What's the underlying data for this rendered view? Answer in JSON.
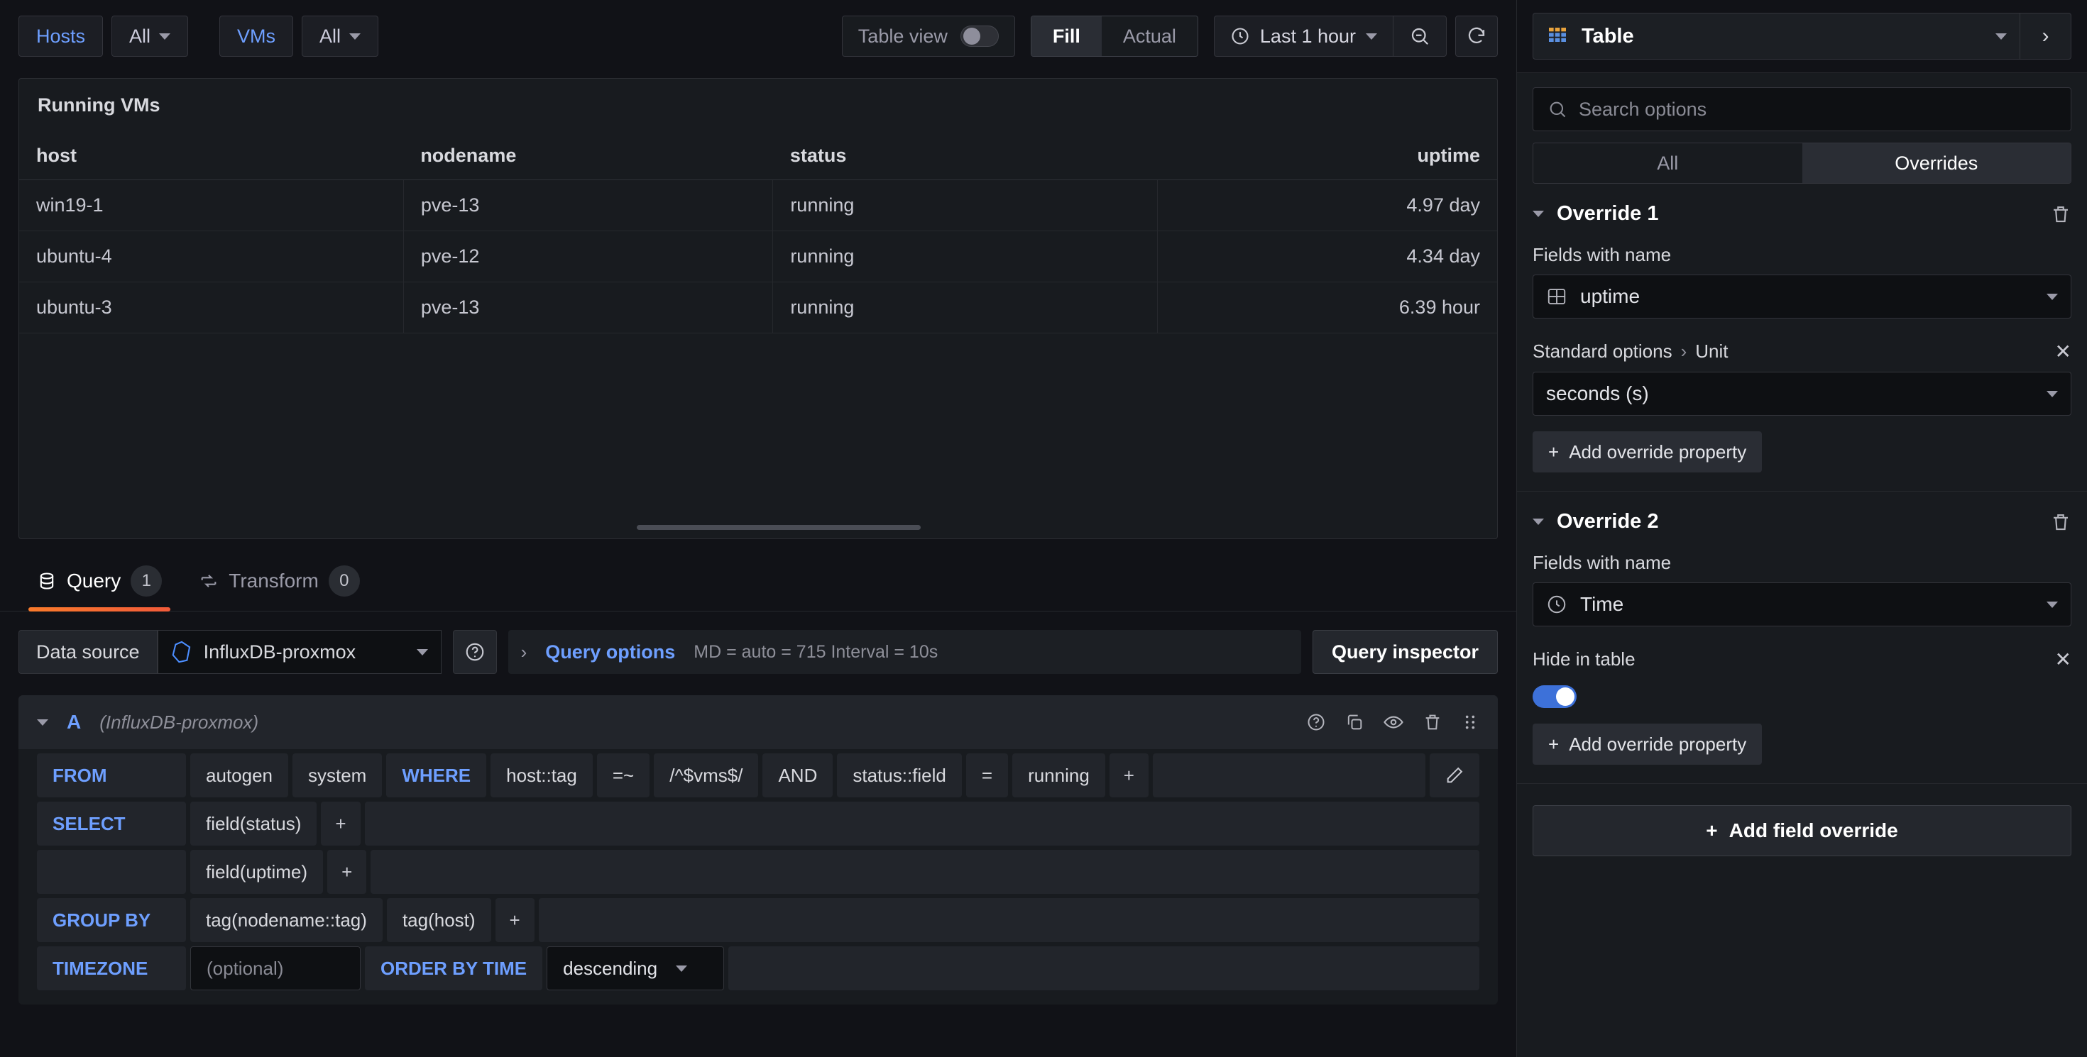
{
  "toolbar": {
    "hosts_label": "Hosts",
    "hosts_value": "All",
    "vms_label": "VMs",
    "vms_value": "All",
    "table_view_label": "Table view",
    "fill_label": "Fill",
    "actual_label": "Actual",
    "time_range": "Last 1 hour",
    "zoom_out_icon": "zoom-out-icon",
    "refresh_icon": "refresh-icon"
  },
  "panel": {
    "title": "Running VMs",
    "columns": [
      "host",
      "nodename",
      "status",
      "uptime"
    ],
    "rows": [
      {
        "host": "win19-1",
        "nodename": "pve-13",
        "status": "running",
        "uptime": "4.97 day"
      },
      {
        "host": "ubuntu-4",
        "nodename": "pve-12",
        "status": "running",
        "uptime": "4.34 day"
      },
      {
        "host": "ubuntu-3",
        "nodename": "pve-13",
        "status": "running",
        "uptime": "6.39 hour"
      }
    ]
  },
  "tabs": {
    "query_label": "Query",
    "query_count": "1",
    "transform_label": "Transform",
    "transform_count": "0"
  },
  "datasource": {
    "label": "Data source",
    "value": "InfluxDB-proxmox",
    "query_options_label": "Query options",
    "query_options_meta": "MD = auto = 715    Interval = 10s",
    "query_inspector_label": "Query inspector"
  },
  "query": {
    "ref_id": "A",
    "ds_name": "(InfluxDB-proxmox)",
    "from_kw": "FROM",
    "from_policy": "autogen",
    "from_measurement": "system",
    "where_kw": "WHERE",
    "where_tag": "host::tag",
    "where_op": "=~",
    "where_value": "/^$vms$/",
    "where_and": "AND",
    "where_tag2": "status::field",
    "where_op2": "=",
    "where_value2": "running",
    "plus": "+",
    "select_kw": "SELECT",
    "select_field1": "field(status)",
    "select_field2": "field(uptime)",
    "groupby_kw": "GROUP BY",
    "groupby_1": "tag(nodename::tag)",
    "groupby_2": "tag(host)",
    "timezone_kw": "TIMEZONE",
    "timezone_placeholder": "(optional)",
    "orderby_kw": "ORDER BY TIME",
    "orderby_value": "descending"
  },
  "side": {
    "viz_name": "Table",
    "viz_icon": "table-icon",
    "search_placeholder": "Search options",
    "tab_all": "All",
    "tab_overrides": "Overrides",
    "add_field_override": "Add field override",
    "overrides": [
      {
        "title": "Override 1",
        "matcher_label": "Fields with name",
        "matcher_value": "uptime",
        "matcher_icon": "field-icon",
        "property_label": "Standard options",
        "property_sep": "›",
        "property_name": "Unit",
        "property_value": "seconds (s)",
        "property_kind": "select",
        "add_property_label": "Add override property",
        "close_label": "✕"
      },
      {
        "title": "Override 2",
        "matcher_label": "Fields with name",
        "matcher_value": "Time",
        "matcher_icon": "clock-icon",
        "property_label": "Hide in table",
        "property_sep": "",
        "property_name": "",
        "property_value": "on",
        "property_kind": "toggle",
        "add_property_label": "Add override property",
        "close_label": "✕"
      }
    ]
  },
  "colors": {
    "accent_blue": "#6e9fff",
    "toggle_on": "#3d71d9",
    "tab_underline": "#f97a2b",
    "panel_bg": "#181b1f",
    "app_bg": "#111217"
  }
}
